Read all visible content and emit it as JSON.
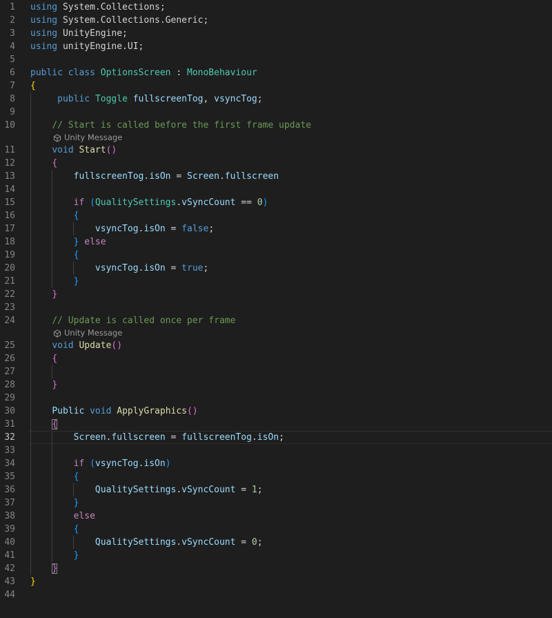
{
  "editor": {
    "lines": [
      {
        "num": "1",
        "tokens": [
          {
            "t": "using",
            "c": "kw"
          },
          {
            "t": " System.Collections;",
            "c": "ns"
          }
        ]
      },
      {
        "num": "2",
        "tokens": [
          {
            "t": "using",
            "c": "kw"
          },
          {
            "t": " System.Collections.Generic;",
            "c": "ns"
          }
        ]
      },
      {
        "num": "3",
        "tokens": [
          {
            "t": "using",
            "c": "kw"
          },
          {
            "t": " UnityEngine;",
            "c": "ns"
          }
        ]
      },
      {
        "num": "4",
        "tokens": [
          {
            "t": "using",
            "c": "kw"
          },
          {
            "t": " unityEngine.UI;",
            "c": "ns"
          }
        ]
      },
      {
        "num": "5",
        "tokens": []
      },
      {
        "num": "6",
        "tokens": [
          {
            "t": "public",
            "c": "kw"
          },
          {
            "t": " ",
            "c": "txt"
          },
          {
            "t": "class",
            "c": "kw"
          },
          {
            "t": " ",
            "c": "txt"
          },
          {
            "t": "OptionsScreen",
            "c": "type"
          },
          {
            "t": " : ",
            "c": "txt"
          },
          {
            "t": "MonoBehaviour",
            "c": "type"
          }
        ]
      },
      {
        "num": "7",
        "tokens": [
          {
            "t": "{",
            "c": "br1"
          }
        ]
      },
      {
        "num": "8",
        "tokens": [
          {
            "t": "     ",
            "c": "txt"
          },
          {
            "t": "public",
            "c": "kw"
          },
          {
            "t": " ",
            "c": "txt"
          },
          {
            "t": "Toggle",
            "c": "type"
          },
          {
            "t": " ",
            "c": "txt"
          },
          {
            "t": "fullscreenTog",
            "c": "var"
          },
          {
            "t": ", ",
            "c": "txt"
          },
          {
            "t": "vsyncTog",
            "c": "var"
          },
          {
            "t": ";",
            "c": "txt"
          }
        ]
      },
      {
        "num": "9",
        "tokens": []
      },
      {
        "num": "10",
        "tokens": [
          {
            "t": "    ",
            "c": "txt"
          },
          {
            "t": "// Start is called before the first frame update",
            "c": "cmt"
          }
        ]
      },
      {
        "lens": "Unity Message"
      },
      {
        "num": "11",
        "tokens": [
          {
            "t": "    ",
            "c": "txt"
          },
          {
            "t": "void",
            "c": "kw"
          },
          {
            "t": " ",
            "c": "txt"
          },
          {
            "t": "Start",
            "c": "fn"
          },
          {
            "t": "()",
            "c": "br2"
          }
        ]
      },
      {
        "num": "12",
        "tokens": [
          {
            "t": "    ",
            "c": "txt"
          },
          {
            "t": "{",
            "c": "br2"
          }
        ]
      },
      {
        "num": "13",
        "tokens": [
          {
            "t": "        ",
            "c": "txt"
          },
          {
            "t": "fullscreenTog",
            "c": "var"
          },
          {
            "t": ".",
            "c": "txt"
          },
          {
            "t": "isOn",
            "c": "var"
          },
          {
            "t": " = ",
            "c": "txt"
          },
          {
            "t": "Screen",
            "c": "var"
          },
          {
            "t": ".",
            "c": "txt"
          },
          {
            "t": "fullscreen",
            "c": "var"
          }
        ]
      },
      {
        "num": "14",
        "tokens": []
      },
      {
        "num": "15",
        "tokens": [
          {
            "t": "        ",
            "c": "txt"
          },
          {
            "t": "if",
            "c": "ctl"
          },
          {
            "t": " ",
            "c": "txt"
          },
          {
            "t": "(",
            "c": "br3"
          },
          {
            "t": "QualitySettings",
            "c": "type"
          },
          {
            "t": ".",
            "c": "txt"
          },
          {
            "t": "vSyncCount",
            "c": "var"
          },
          {
            "t": " == ",
            "c": "txt"
          },
          {
            "t": "0",
            "c": "num"
          },
          {
            "t": ")",
            "c": "br3"
          }
        ]
      },
      {
        "num": "16",
        "tokens": [
          {
            "t": "        ",
            "c": "txt"
          },
          {
            "t": "{",
            "c": "br3"
          }
        ]
      },
      {
        "num": "17",
        "tokens": [
          {
            "t": "            ",
            "c": "txt"
          },
          {
            "t": "vsyncTog",
            "c": "var"
          },
          {
            "t": ".",
            "c": "txt"
          },
          {
            "t": "isOn",
            "c": "var"
          },
          {
            "t": " = ",
            "c": "txt"
          },
          {
            "t": "false",
            "c": "kw"
          },
          {
            "t": ";",
            "c": "txt"
          }
        ]
      },
      {
        "num": "18",
        "tokens": [
          {
            "t": "        ",
            "c": "txt"
          },
          {
            "t": "}",
            "c": "br3"
          },
          {
            "t": " ",
            "c": "txt"
          },
          {
            "t": "else",
            "c": "ctl"
          }
        ]
      },
      {
        "num": "19",
        "tokens": [
          {
            "t": "        ",
            "c": "txt"
          },
          {
            "t": "{",
            "c": "br3"
          }
        ]
      },
      {
        "num": "20",
        "tokens": [
          {
            "t": "            ",
            "c": "txt"
          },
          {
            "t": "vsyncTog",
            "c": "var"
          },
          {
            "t": ".",
            "c": "txt"
          },
          {
            "t": "isOn",
            "c": "var"
          },
          {
            "t": " = ",
            "c": "txt"
          },
          {
            "t": "true",
            "c": "kw"
          },
          {
            "t": ";",
            "c": "txt"
          }
        ]
      },
      {
        "num": "21",
        "tokens": [
          {
            "t": "        ",
            "c": "txt"
          },
          {
            "t": "}",
            "c": "br3"
          }
        ]
      },
      {
        "num": "22",
        "tokens": [
          {
            "t": "    ",
            "c": "txt"
          },
          {
            "t": "}",
            "c": "br2"
          }
        ]
      },
      {
        "num": "23",
        "tokens": []
      },
      {
        "num": "24",
        "tokens": [
          {
            "t": "    ",
            "c": "txt"
          },
          {
            "t": "// Update is called once per frame",
            "c": "cmt"
          }
        ]
      },
      {
        "lens": "Unity Message"
      },
      {
        "num": "25",
        "tokens": [
          {
            "t": "    ",
            "c": "txt"
          },
          {
            "t": "void",
            "c": "kw"
          },
          {
            "t": " ",
            "c": "txt"
          },
          {
            "t": "Update",
            "c": "fn"
          },
          {
            "t": "()",
            "c": "br2"
          }
        ]
      },
      {
        "num": "26",
        "tokens": [
          {
            "t": "    ",
            "c": "txt"
          },
          {
            "t": "{",
            "c": "br2"
          }
        ]
      },
      {
        "num": "27",
        "tokens": []
      },
      {
        "num": "28",
        "tokens": [
          {
            "t": "    ",
            "c": "txt"
          },
          {
            "t": "}",
            "c": "br2"
          }
        ]
      },
      {
        "num": "29",
        "tokens": []
      },
      {
        "num": "30",
        "tokens": [
          {
            "t": "    ",
            "c": "txt"
          },
          {
            "t": "Public",
            "c": "var"
          },
          {
            "t": " ",
            "c": "txt"
          },
          {
            "t": "void",
            "c": "kw"
          },
          {
            "t": " ",
            "c": "txt"
          },
          {
            "t": "ApplyGraphics",
            "c": "fn"
          },
          {
            "t": "()",
            "c": "br2"
          }
        ]
      },
      {
        "num": "31",
        "tokens": [
          {
            "t": "    ",
            "c": "txt"
          },
          {
            "t": "{",
            "c": "br2",
            "match": true
          }
        ]
      },
      {
        "num": "32",
        "current": true,
        "tokens": [
          {
            "t": "        ",
            "c": "txt"
          },
          {
            "t": "Screen",
            "c": "var"
          },
          {
            "t": ".",
            "c": "txt"
          },
          {
            "t": "fullscreen",
            "c": "var"
          },
          {
            "t": " = ",
            "c": "txt"
          },
          {
            "t": "fullscreenTog",
            "c": "var"
          },
          {
            "t": ".",
            "c": "txt"
          },
          {
            "t": "isOn",
            "c": "var"
          },
          {
            "t": ";",
            "c": "txt"
          }
        ]
      },
      {
        "num": "33",
        "tokens": []
      },
      {
        "num": "34",
        "tokens": [
          {
            "t": "        ",
            "c": "txt"
          },
          {
            "t": "if",
            "c": "ctl"
          },
          {
            "t": " ",
            "c": "txt"
          },
          {
            "t": "(",
            "c": "br3"
          },
          {
            "t": "vsyncTog",
            "c": "var"
          },
          {
            "t": ".",
            "c": "txt"
          },
          {
            "t": "isOn",
            "c": "var"
          },
          {
            "t": ")",
            "c": "br3"
          }
        ]
      },
      {
        "num": "35",
        "tokens": [
          {
            "t": "        ",
            "c": "txt"
          },
          {
            "t": "{",
            "c": "br3"
          }
        ]
      },
      {
        "num": "36",
        "tokens": [
          {
            "t": "            ",
            "c": "txt"
          },
          {
            "t": "QualitySettings",
            "c": "var"
          },
          {
            "t": ".",
            "c": "txt"
          },
          {
            "t": "vSyncCount",
            "c": "var"
          },
          {
            "t": " = ",
            "c": "txt"
          },
          {
            "t": "1",
            "c": "num"
          },
          {
            "t": ";",
            "c": "txt"
          }
        ]
      },
      {
        "num": "37",
        "tokens": [
          {
            "t": "        ",
            "c": "txt"
          },
          {
            "t": "}",
            "c": "br3"
          }
        ]
      },
      {
        "num": "38",
        "tokens": [
          {
            "t": "        ",
            "c": "txt"
          },
          {
            "t": "else",
            "c": "ctl"
          }
        ]
      },
      {
        "num": "39",
        "tokens": [
          {
            "t": "        ",
            "c": "txt"
          },
          {
            "t": "{",
            "c": "br3"
          }
        ]
      },
      {
        "num": "40",
        "tokens": [
          {
            "t": "            ",
            "c": "txt"
          },
          {
            "t": "QualitySettings",
            "c": "var"
          },
          {
            "t": ".",
            "c": "txt"
          },
          {
            "t": "vSyncCount",
            "c": "var"
          },
          {
            "t": " = ",
            "c": "txt"
          },
          {
            "t": "0",
            "c": "num"
          },
          {
            "t": ";",
            "c": "txt"
          }
        ]
      },
      {
        "num": "41",
        "tokens": [
          {
            "t": "        ",
            "c": "txt"
          },
          {
            "t": "}",
            "c": "br3"
          }
        ]
      },
      {
        "num": "42",
        "tokens": [
          {
            "t": "    ",
            "c": "txt"
          },
          {
            "t": "}",
            "c": "br2",
            "match": true
          }
        ]
      },
      {
        "num": "43",
        "tokens": [
          {
            "t": "}",
            "c": "br1"
          }
        ]
      },
      {
        "num": "44",
        "tokens": []
      }
    ]
  },
  "theme": {
    "background": "#1e1e1e",
    "line_number": "#858585",
    "keyword": "#569cd6",
    "type": "#4ec9b0",
    "variable": "#9cdcfe",
    "function": "#dcdcaa",
    "comment": "#6a9955"
  }
}
